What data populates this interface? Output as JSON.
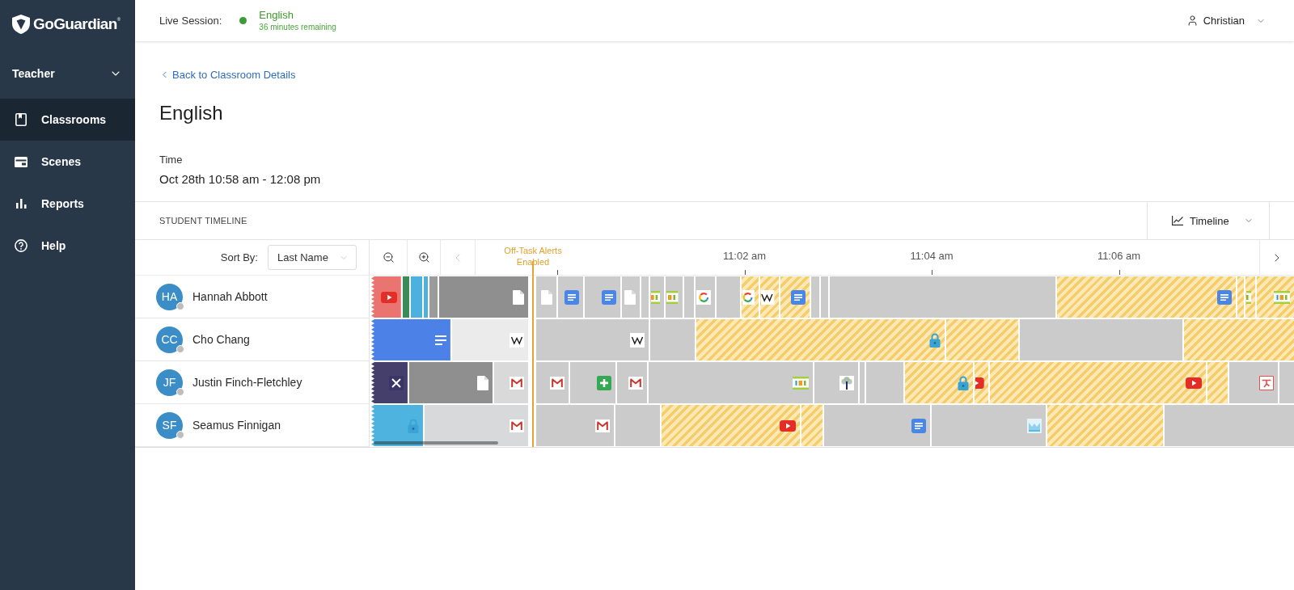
{
  "sidebar": {
    "logo": "GoGuardian$^{®}$",
    "role": "Teacher",
    "items": [
      {
        "label": "Classrooms",
        "selected": true
      },
      {
        "label": "Scenes",
        "selected": false
      },
      {
        "label": "Reports",
        "selected": false
      },
      {
        "label": "Help",
        "selected": false
      }
    ]
  },
  "header": {
    "session_label": "Live Session:",
    "session_name": "English",
    "session_remaining": "36 minutes remaining",
    "user": "Christian"
  },
  "page": {
    "back_link": "Back to Classroom Details",
    "title": "English",
    "time_label": "Time",
    "time_value": "Oct 28th 10:58 am - 12:08 pm"
  },
  "timeline": {
    "heading": "STUDENT TIMELINE",
    "view": "Timeline",
    "sort_label": "Sort By:",
    "sort_value": "Last Name",
    "previous": {
      "disabled": true
    },
    "next": {
      "disabled": false
    },
    "marker": "Off-Task Alerts Enabled",
    "time_labels": [
      "11:02 am",
      "11:04 am",
      "11:06 am"
    ],
    "students": [
      {
        "initials": "HA",
        "name": "Hannah Abbott",
        "online": false,
        "before_alerts": {
          "cut_off_start": true,
          "segments": [
            {
              "kind": "video",
              "off_task": false,
              "color": "#ea7470",
              "level": 0.2
            },
            {
              "kind": "blank",
              "off_task": false,
              "color": "#3a8b55",
              "level": 0.052
            },
            {
              "kind": "blank",
              "off_task": false,
              "color": "#4cb1df",
              "level": 0.082
            },
            {
              "kind": "blank",
              "off_task": false,
              "color": "#4cb1df",
              "level": 0.036
            },
            {
              "kind": "blank",
              "off_task": false,
              "color": "#9b9b9b",
              "level": 0.062
            },
            {
              "kind": "page",
              "off_task": false,
              "color": "#8f8f8f",
              "level": 0.568
            }
          ]
        },
        "after_alerts": {
          "segments": [
            {
              "kind": "page",
              "off_task": false,
              "level": 0.029
            },
            {
              "kind": "document",
              "off_task": false,
              "level": 0.035
            },
            {
              "kind": "document",
              "off_task": false,
              "level": 0.049
            },
            {
              "kind": "page",
              "off_task": false,
              "level": 0.026
            },
            {
              "kind": "blank",
              "off_task": false,
              "level": 0.011
            },
            {
              "kind": "banded",
              "off_task": false,
              "level": 0.021
            },
            {
              "kind": "banded",
              "off_task": false,
              "level": 0.024
            },
            {
              "kind": "blank",
              "off_task": false,
              "level": 0.015
            },
            {
              "kind": "ring",
              "off_task": false,
              "level": 0.028
            },
            {
              "kind": "blank",
              "off_task": false,
              "level": 0.033
            },
            {
              "kind": "ring",
              "off_task": true,
              "level": 0.025
            },
            {
              "kind": "zigzag",
              "off_task": true,
              "level": 0.026
            },
            {
              "kind": "document",
              "off_task": true,
              "level": 0.041
            },
            {
              "kind": "blank",
              "off_task": false,
              "level": 0.013
            },
            {
              "kind": "blank",
              "off_task": false,
              "level": 0.011
            },
            {
              "kind": "blank",
              "off_task": false,
              "level": 0.3
            },
            {
              "kind": "document",
              "off_task": true,
              "level": 0.238
            },
            {
              "kind": "blank",
              "off_task": true,
              "level": 0.011
            },
            {
              "kind": "banded",
              "off_task": true,
              "level": 0.015
            },
            {
              "kind": "banded",
              "off_task": true,
              "level": 0.049
            }
          ]
        }
      },
      {
        "initials": "CC",
        "name": "Cho Chang",
        "online": false,
        "before_alerts": {
          "cut_off_start": true,
          "segments": [
            {
              "kind": "lines",
              "off_task": false,
              "color": "#4c82e8",
              "level": 0.515
            },
            {
              "kind": "zigzag",
              "off_task": false,
              "color": "#ebebeb",
              "level": 0.485
            }
          ]
        },
        "after_alerts": {
          "segments": [
            {
              "kind": "zigzag",
              "off_task": false,
              "level": 0.15
            },
            {
              "kind": "blank",
              "off_task": false,
              "level": 0.061
            },
            {
              "kind": "padlock",
              "off_task": true,
              "level": 0.33
            },
            {
              "kind": "blank",
              "off_task": true,
              "level": 0.097
            },
            {
              "kind": "blank",
              "off_task": false,
              "level": 0.217
            },
            {
              "kind": "blank",
              "off_task": true,
              "level": 0.145
            }
          ]
        }
      },
      {
        "initials": "JF",
        "name": "Justin Finch-Fletchley",
        "online": false,
        "before_alerts": {
          "cut_off_start": true,
          "segments": [
            {
              "kind": "xmark",
              "off_task": false,
              "color": "#453f6c",
              "level": 0.242
            },
            {
              "kind": "page",
              "off_task": false,
              "color": "#8f8f8f",
              "level": 0.541
            },
            {
              "kind": "mail",
              "off_task": false,
              "color": "#d9d9d9",
              "level": 0.217
            }
          ]
        },
        "after_alerts": {
          "segments": [
            {
              "kind": "mail",
              "off_task": false,
              "level": 0.045
            },
            {
              "kind": "cross",
              "off_task": false,
              "level": 0.062
            },
            {
              "kind": "mail",
              "off_task": false,
              "level": 0.041
            },
            {
              "kind": "banded",
              "off_task": false,
              "level": 0.219
            },
            {
              "kind": "tree",
              "off_task": false,
              "level": 0.06
            },
            {
              "kind": "blank",
              "off_task": false,
              "level": 0.009
            },
            {
              "kind": "blank",
              "off_task": false,
              "level": 0.051
            },
            {
              "kind": "padlock",
              "off_task": true,
              "level": 0.092
            },
            {
              "kind": "video",
              "off_task": true,
              "level": 0.02
            },
            {
              "kind": "video",
              "off_task": true,
              "level": 0.287
            },
            {
              "kind": "blank",
              "off_task": true,
              "level": 0.029
            },
            {
              "kind": "figure",
              "off_task": false,
              "level": 0.066
            },
            {
              "kind": "blank",
              "off_task": false,
              "level": 0.019
            }
          ]
        }
      },
      {
        "initials": "SF",
        "name": "Seamus Finnigan",
        "online": false,
        "before_alerts": {
          "cut_off_start": true,
          "segments": [
            {
              "kind": "padlock",
              "off_task": false,
              "color": "#4eb3de",
              "level": 0.34
            },
            {
              "kind": "mail",
              "off_task": false,
              "color": "#d7d9da",
              "level": 0.66
            }
          ]
        },
        "after_alerts": {
          "segments": [
            {
              "kind": "mail",
              "off_task": false,
              "level": 0.105
            },
            {
              "kind": "blank",
              "off_task": false,
              "level": 0.06
            },
            {
              "kind": "video",
              "off_task": true,
              "level": 0.185
            },
            {
              "kind": "blank",
              "off_task": true,
              "level": 0.03
            },
            {
              "kind": "document",
              "off_task": false,
              "level": 0.142
            },
            {
              "kind": "picture",
              "off_task": false,
              "level": 0.152
            },
            {
              "kind": "blank",
              "off_task": true,
              "level": 0.155
            },
            {
              "kind": "blank",
              "off_task": false,
              "level": 0.171
            }
          ]
        }
      }
    ]
  }
}
